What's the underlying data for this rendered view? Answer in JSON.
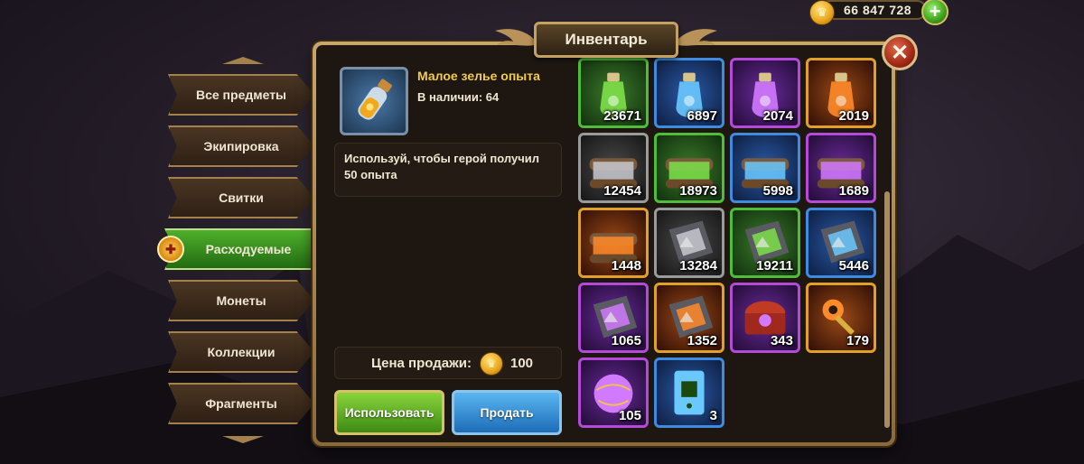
{
  "title": "Инвентарь",
  "currency": {
    "value": "66 847 728",
    "icon": "crown-coin-icon",
    "add_icon": "plus-icon"
  },
  "tabs": [
    {
      "label": "Все предметы",
      "active": false
    },
    {
      "label": "Экипировка",
      "active": false
    },
    {
      "label": "Свитки",
      "active": false
    },
    {
      "label": "Расходуемые",
      "active": true
    },
    {
      "label": "Монеты",
      "active": false
    },
    {
      "label": "Коллекции",
      "active": false
    },
    {
      "label": "Фрагменты",
      "active": false
    }
  ],
  "selected_item": {
    "name": "Малое зелье опыта",
    "stock": "В наличии: 64",
    "description": "Используй, чтобы герой получил 50 опыта",
    "price_label": "Цена продажи:",
    "price_value": "100",
    "icon": "experience-potion-icon"
  },
  "buttons": {
    "use": "Использовать",
    "sell": "Продать"
  },
  "items": [
    {
      "qty": "23671",
      "rarity": "green",
      "icon": "potion-green-icon"
    },
    {
      "qty": "6897",
      "rarity": "blue",
      "icon": "potion-blue-icon"
    },
    {
      "qty": "2074",
      "rarity": "purple",
      "icon": "potion-purple-icon"
    },
    {
      "qty": "2019",
      "rarity": "orange",
      "icon": "potion-orange-icon"
    },
    {
      "qty": "12454",
      "rarity": "gray",
      "icon": "scroll-gray-icon"
    },
    {
      "qty": "18973",
      "rarity": "green",
      "icon": "scroll-green-icon"
    },
    {
      "qty": "5998",
      "rarity": "blue",
      "icon": "scroll-blue-icon"
    },
    {
      "qty": "1689",
      "rarity": "purple",
      "icon": "scroll-purple-icon"
    },
    {
      "qty": "1448",
      "rarity": "orange",
      "icon": "scroll-orange-icon"
    },
    {
      "qty": "13284",
      "rarity": "gray",
      "icon": "rune-stone-gray-icon"
    },
    {
      "qty": "19211",
      "rarity": "green",
      "icon": "rune-stone-green-icon"
    },
    {
      "qty": "5446",
      "rarity": "blue",
      "icon": "rune-stone-blue-icon"
    },
    {
      "qty": "1065",
      "rarity": "purple",
      "icon": "rune-stone-purple-icon"
    },
    {
      "qty": "1352",
      "rarity": "orange",
      "icon": "rune-stone-orange-icon"
    },
    {
      "qty": "343",
      "rarity": "purple",
      "icon": "chest-icon"
    },
    {
      "qty": "179",
      "rarity": "orange",
      "icon": "key-icon"
    },
    {
      "qty": "105",
      "rarity": "purple",
      "icon": "orb-icon"
    },
    {
      "qty": "3",
      "rarity": "blue",
      "icon": "ticket-icon"
    }
  ],
  "colors": {
    "green": "#4fbd3a",
    "blue": "#3f8be0",
    "purple": "#b54ad8",
    "orange": "#e0a02a",
    "gray": "#9a9a9a"
  }
}
